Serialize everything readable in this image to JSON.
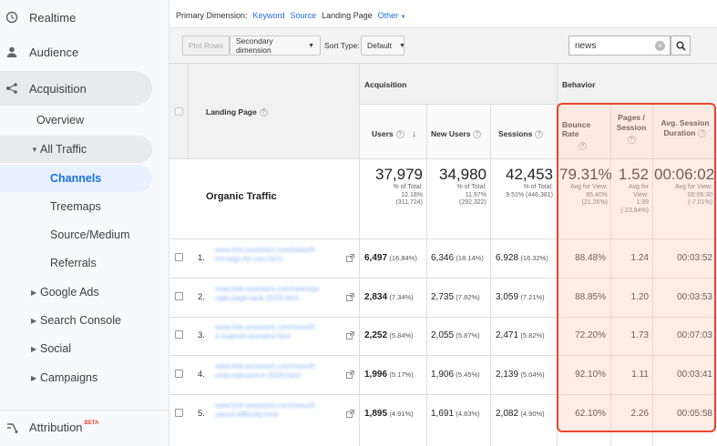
{
  "sidebar": {
    "realtime": "Realtime",
    "audience": "Audience",
    "acquisition": "Acquisition",
    "overview": "Overview",
    "all_traffic": "All Traffic",
    "channels": "Channels",
    "treemaps": "Treemaps",
    "source_medium": "Source/Medium",
    "referrals": "Referrals",
    "google_ads": "Google Ads",
    "search_console": "Search Console",
    "social": "Social",
    "campaigns": "Campaigns",
    "attribution": "Attribution",
    "attribution_badge": "BETA"
  },
  "dimensions": {
    "label": "Primary Dimension:",
    "keyword": "Keyword",
    "source": "Source",
    "landing_page": "Landing Page",
    "other": "Other"
  },
  "toolbar": {
    "plot_rows": "Plot Rows",
    "secondary_dimension": "Secondary dimension",
    "sort_type_label": "Sort Type:",
    "sort_type_value": "Default",
    "search_value": "news"
  },
  "table": {
    "col_landing_page": "Landing Page",
    "group_acquisition": "Acquisition",
    "group_behavior": "Behavior",
    "col_users": "Users",
    "col_new_users": "New Users",
    "col_sessions": "Sessions",
    "col_bounce_rate": "Bounce Rate",
    "col_pages_session": "Pages / Session",
    "col_pages_session_l1": "Pages /",
    "col_pages_session_l2": "Session",
    "col_avg_duration_l1": "Avg. Session",
    "col_avg_duration_l2": "Duration",
    "segment": "Organic Traffic",
    "totals": {
      "users": "37,979",
      "users_sub1": "% of Total:",
      "users_sub2": "12.18%",
      "users_sub3": "(311,724)",
      "new_users": "34,980",
      "new_users_sub1": "% of Total:",
      "new_users_sub2": "11.97%",
      "new_users_sub3": "(292,322)",
      "sessions": "42,453",
      "sessions_sub1": "% of Total:",
      "sessions_sub2": "9.51% (446,381)",
      "bounce": "79.31%",
      "bounce_sub1": "Avg for View:",
      "bounce_sub2": "65.40%",
      "bounce_sub3": "(21.26%)",
      "pages": "1.52",
      "pages_sub1": "Avg for",
      "pages_sub2": "View:",
      "pages_sub3": "1.99",
      "pages_sub4": "(-23.84%)",
      "duration": "00:06:02",
      "duration_sub1": "Avg for View:",
      "duration_sub2": "00:06:30",
      "duration_sub3": "(-7.01%)"
    },
    "rows": [
      {
        "num": "1.",
        "url1": "www.link-assistant.com/news/h",
        "url2": "tml-tags-for-seo.html",
        "users": "6,497",
        "users_pct": "(16.84%)",
        "new_users": "6,346",
        "new_users_pct": "(18.14%)",
        "sessions": "6,928",
        "sessions_pct": "(16.32%)",
        "bounce": "88.48%",
        "pages": "1.24",
        "duration": "00:03:52"
      },
      {
        "num": "2.",
        "url1": "www.link-assistant.com/news/go",
        "url2": "ogle-page-rank-2019.html",
        "users": "2,834",
        "users_pct": "(7.34%)",
        "new_users": "2,735",
        "new_users_pct": "(7.82%)",
        "sessions": "3,059",
        "sessions_pct": "(7.21%)",
        "bounce": "88.85%",
        "pages": "1.20",
        "duration": "00:03:53"
      },
      {
        "num": "3.",
        "url1": "www.link-assistant.com/news/h",
        "url2": "d-expired-domains.html",
        "users": "2,252",
        "users_pct": "(5.84%)",
        "new_users": "2,055",
        "new_users_pct": "(5.87%)",
        "sessions": "2,471",
        "sessions_pct": "(5.82%)",
        "bounce": "72.20%",
        "pages": "1.73",
        "duration": "00:07:03"
      },
      {
        "num": "4.",
        "url1": "www.link-assistant.com/news/h",
        "url2": "amp-relevant-in-2020.html",
        "users": "1,996",
        "users_pct": "(5.17%)",
        "new_users": "1,906",
        "new_users_pct": "(5.45%)",
        "sessions": "2,139",
        "sessions_pct": "(5.04%)",
        "bounce": "92.10%",
        "pages": "1.11",
        "duration": "00:03:41"
      },
      {
        "num": "5.",
        "url1": "www.link-assistant.com/news/h",
        "url2": "yword-difficulty.html",
        "users": "1,895",
        "users_pct": "(4.91%)",
        "new_users": "1,691",
        "new_users_pct": "(4.83%)",
        "sessions": "2,082",
        "sessions_pct": "(4.90%)",
        "bounce": "62.10%",
        "pages": "2.26",
        "duration": "00:05:58"
      }
    ]
  },
  "colors": {
    "accent": "#1a73e8",
    "highlight_border": "#e8452c"
  }
}
